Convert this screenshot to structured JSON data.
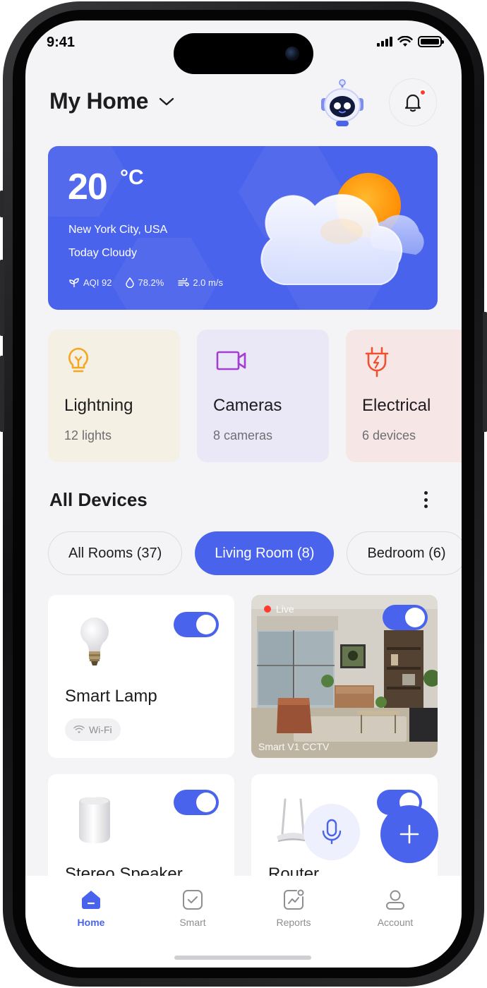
{
  "status_bar": {
    "time": "9:41"
  },
  "header": {
    "title": "My Home"
  },
  "weather": {
    "temperature": "20",
    "unit": "°C",
    "location": "New York City, USA",
    "condition": "Today Cloudy",
    "aqi": "AQI 92",
    "humidity": "78.2%",
    "wind": "2.0 m/s"
  },
  "categories": [
    {
      "name": "Lightning",
      "count": "12 lights",
      "bg": "#f4f0e3",
      "accent": "#f5a623",
      "icon": "lightbulb-icon"
    },
    {
      "name": "Cameras",
      "count": "8 cameras",
      "bg": "#eae8f6",
      "accent": "#a23fd0",
      "icon": "video-camera-icon"
    },
    {
      "name": "Electrical",
      "count": "6 devices",
      "bg": "#f6e6e6",
      "accent": "#f0502e",
      "icon": "plug-icon"
    }
  ],
  "devices_section": {
    "title": "All Devices"
  },
  "rooms": [
    {
      "label": "All Rooms (37)",
      "active": false
    },
    {
      "label": "Living Room (8)",
      "active": true
    },
    {
      "label": "Bedroom (6)",
      "active": false
    }
  ],
  "devices": {
    "lamp": {
      "name": "Smart Lamp",
      "connection": "Wi-Fi",
      "on": true
    },
    "cctv": {
      "live": "Live",
      "name": "Smart V1 CCTV",
      "on": true
    },
    "speaker": {
      "name": "Stereo Speaker",
      "on": true
    },
    "router": {
      "name": "Router",
      "on": true
    }
  },
  "nav": {
    "items": [
      {
        "label": "Home",
        "icon": "home-icon",
        "active": true
      },
      {
        "label": "Smart",
        "icon": "checkbox-icon",
        "active": false
      },
      {
        "label": "Reports",
        "icon": "chart-icon",
        "active": false
      },
      {
        "label": "Account",
        "icon": "user-icon",
        "active": false
      }
    ]
  },
  "colors": {
    "accent": "#4a63ec",
    "background": "#f4f4f6"
  }
}
